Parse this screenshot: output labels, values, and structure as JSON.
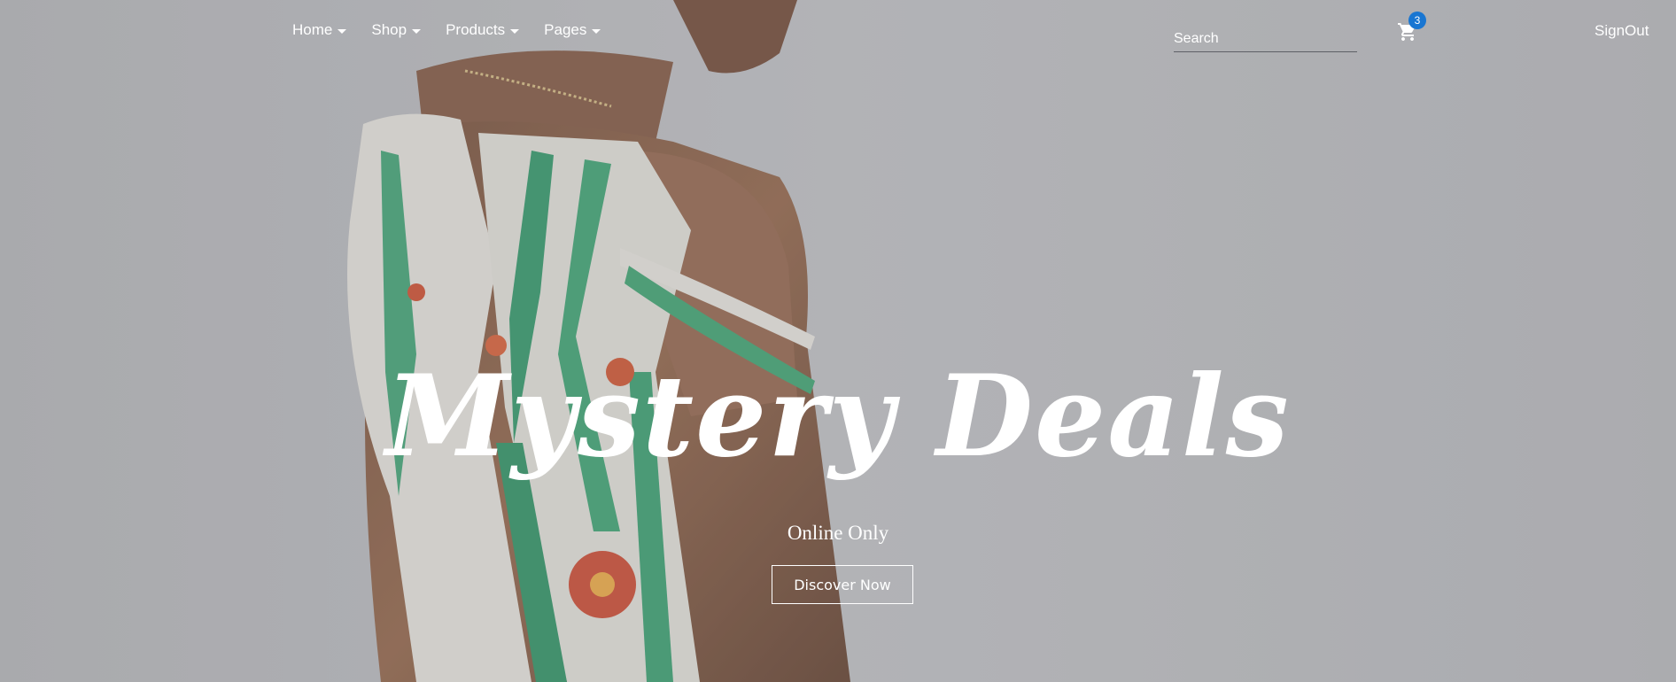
{
  "nav": {
    "items": [
      {
        "label": "Home"
      },
      {
        "label": "Shop"
      },
      {
        "label": "Products"
      },
      {
        "label": "Pages"
      }
    ]
  },
  "search": {
    "placeholder": "Search"
  },
  "cart": {
    "count": "3",
    "icon": "shopping-cart-icon",
    "badge_color": "#1976d2"
  },
  "account": {
    "signout_label": "SignOut"
  },
  "hero": {
    "title": "Mystery Deals",
    "subtitle": "Online Only",
    "cta_label": "Discover Now"
  }
}
